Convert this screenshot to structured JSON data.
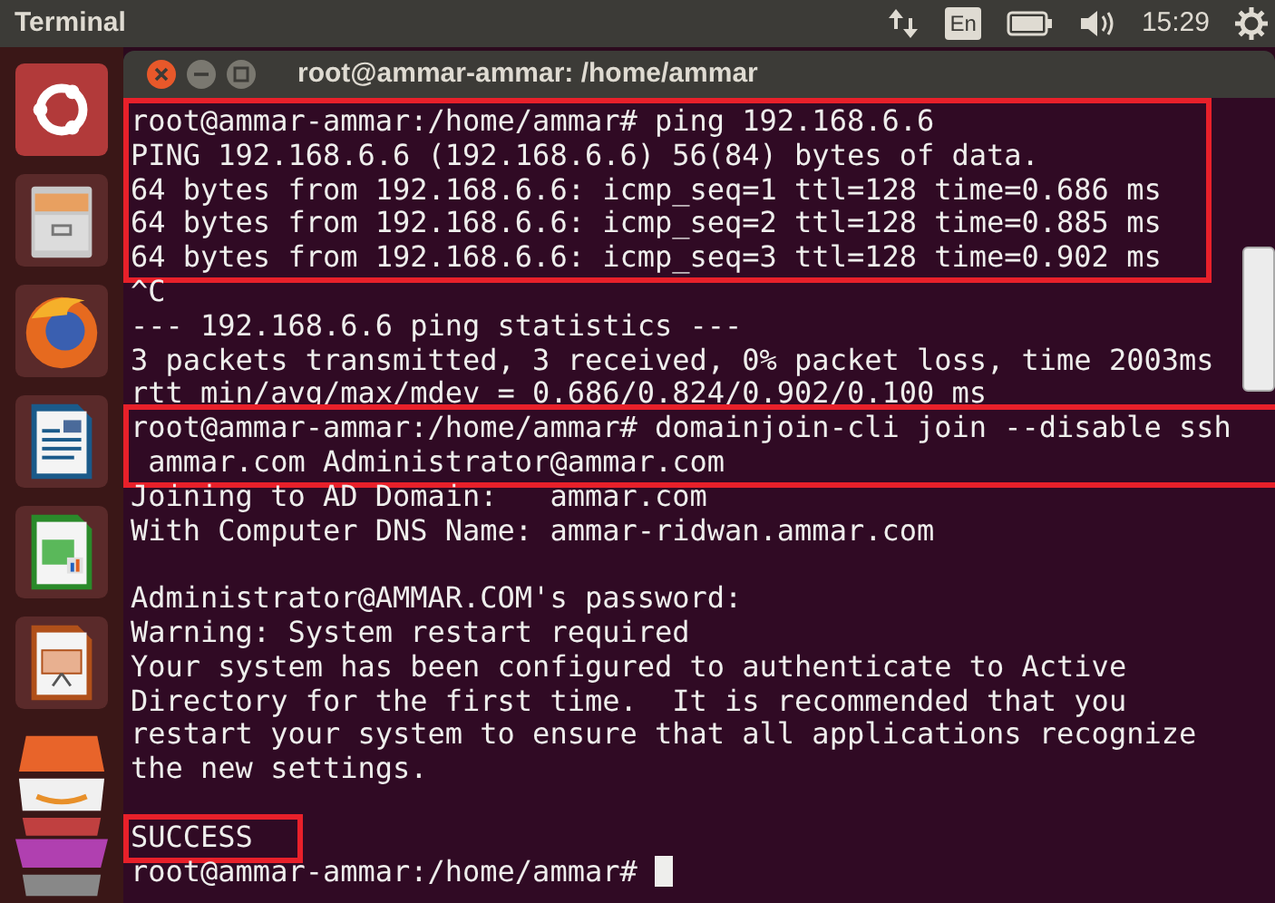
{
  "top_panel": {
    "app_title": "Terminal",
    "language": "En",
    "clock": "15:29"
  },
  "window": {
    "title": "root@ammar-ammar: /home/ammar"
  },
  "terminal": {
    "blocks": [
      {
        "highlighted": true,
        "cursor": false,
        "lines": [
          "root@ammar-ammar:/home/ammar# ping 192.168.6.6",
          "PING 192.168.6.6 (192.168.6.6) 56(84) bytes of data.",
          "64 bytes from 192.168.6.6: icmp_seq=1 ttl=128 time=0.686 ms",
          "64 bytes from 192.168.6.6: icmp_seq=2 ttl=128 time=0.885 ms",
          "64 bytes from 192.168.6.6: icmp_seq=3 ttl=128 time=0.902 ms"
        ]
      },
      {
        "highlighted": false,
        "cursor": false,
        "lines": [
          "^C",
          "--- 192.168.6.6 ping statistics ---",
          "3 packets transmitted, 3 received, 0% packet loss, time 2003ms",
          "rtt min/avg/max/mdev = 0.686/0.824/0.902/0.100 ms"
        ]
      },
      {
        "highlighted": true,
        "cursor": false,
        "lines": [
          "root@ammar-ammar:/home/ammar# domainjoin-cli join --disable ssh",
          " ammar.com Administrator@ammar.com"
        ]
      },
      {
        "highlighted": false,
        "cursor": false,
        "blank_line_after": true,
        "lines": [
          "Joining to AD Domain:   ammar.com",
          "With Computer DNS Name: ammar-ridwan.ammar.com"
        ]
      },
      {
        "highlighted": false,
        "cursor": false,
        "blank_line_after": true,
        "lines": [
          "Administrator@AMMAR.COM's password:",
          "Warning: System restart required",
          "Your system has been configured to authenticate to Active",
          "Directory for the first time.  It is recommended that you",
          "restart your system to ensure that all applications recognize",
          "the new settings."
        ]
      },
      {
        "highlighted": true,
        "cursor": false,
        "lines": [
          "SUCCESS"
        ]
      },
      {
        "highlighted": false,
        "cursor": true,
        "lines": [
          "root@ammar-ammar:/home/ammar# "
        ]
      }
    ]
  }
}
